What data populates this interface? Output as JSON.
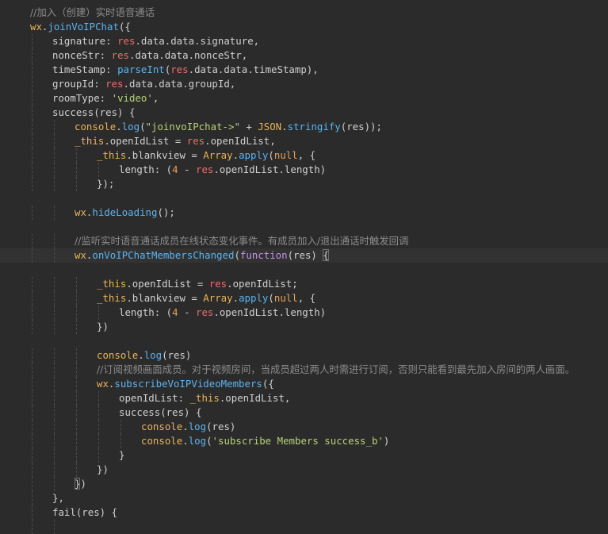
{
  "editor": {
    "current_line": 18,
    "matched_bracket": [
      18,
      33
    ],
    "lines": [
      {
        "indent": 1,
        "tokens": [
          {
            "t": "//加入（创建）实时语音通话",
            "c": "comment"
          }
        ]
      },
      {
        "indent": 1,
        "tokens": [
          {
            "t": "wx",
            "c": "wx"
          },
          {
            "t": ".",
            "c": "punct"
          },
          {
            "t": "joinVoIPChat",
            "c": "method"
          },
          {
            "t": "({",
            "c": "punct"
          }
        ]
      },
      {
        "indent": 2,
        "tokens": [
          {
            "t": "signature: ",
            "c": "ident"
          },
          {
            "t": "res",
            "c": "res"
          },
          {
            "t": ".data.data.signature,",
            "c": "ident"
          }
        ]
      },
      {
        "indent": 2,
        "tokens": [
          {
            "t": "nonceStr: ",
            "c": "ident"
          },
          {
            "t": "res",
            "c": "res"
          },
          {
            "t": ".data.data.nonceStr,",
            "c": "ident"
          }
        ]
      },
      {
        "indent": 2,
        "tokens": [
          {
            "t": "timeStamp: ",
            "c": "ident"
          },
          {
            "t": "parseInt",
            "c": "method"
          },
          {
            "t": "(",
            "c": "punct"
          },
          {
            "t": "res",
            "c": "res"
          },
          {
            "t": ".data.data.timeStamp),",
            "c": "ident"
          }
        ]
      },
      {
        "indent": 2,
        "tokens": [
          {
            "t": "groupId: ",
            "c": "ident"
          },
          {
            "t": "res",
            "c": "res"
          },
          {
            "t": ".data.data.groupId,",
            "c": "ident"
          }
        ]
      },
      {
        "indent": 2,
        "tokens": [
          {
            "t": "roomType: ",
            "c": "ident"
          },
          {
            "t": "'video'",
            "c": "string"
          },
          {
            "t": ",",
            "c": "punct"
          }
        ]
      },
      {
        "indent": 2,
        "tokens": [
          {
            "t": "success(res) {",
            "c": "ident"
          }
        ]
      },
      {
        "indent": 3,
        "tokens": [
          {
            "t": "console",
            "c": "builtin"
          },
          {
            "t": ".",
            "c": "punct"
          },
          {
            "t": "log",
            "c": "method"
          },
          {
            "t": "(",
            "c": "punct"
          },
          {
            "t": "\"joinvoIPchat->\"",
            "c": "string"
          },
          {
            "t": " + ",
            "c": "punct"
          },
          {
            "t": "JSON",
            "c": "builtin"
          },
          {
            "t": ".",
            "c": "punct"
          },
          {
            "t": "stringify",
            "c": "method"
          },
          {
            "t": "(res));",
            "c": "ident"
          }
        ]
      },
      {
        "indent": 3,
        "tokens": [
          {
            "t": "_this",
            "c": "this"
          },
          {
            "t": ".openIdList = ",
            "c": "ident"
          },
          {
            "t": "res",
            "c": "res"
          },
          {
            "t": ".openIdList,",
            "c": "ident"
          }
        ]
      },
      {
        "indent": 4,
        "tokens": [
          {
            "t": "_this",
            "c": "this"
          },
          {
            "t": ".blankview = ",
            "c": "ident"
          },
          {
            "t": "Array",
            "c": "builtin"
          },
          {
            "t": ".",
            "c": "punct"
          },
          {
            "t": "apply",
            "c": "method"
          },
          {
            "t": "(",
            "c": "punct"
          },
          {
            "t": "null",
            "c": "number"
          },
          {
            "t": ", {",
            "c": "punct"
          }
        ]
      },
      {
        "indent": 5,
        "tokens": [
          {
            "t": "length: (",
            "c": "ident"
          },
          {
            "t": "4",
            "c": "number"
          },
          {
            "t": " - ",
            "c": "punct"
          },
          {
            "t": "res",
            "c": "res"
          },
          {
            "t": ".openIdList.length)",
            "c": "ident"
          }
        ]
      },
      {
        "indent": 4,
        "tokens": [
          {
            "t": "});",
            "c": "punct"
          }
        ]
      },
      {
        "indent": 0,
        "tokens": []
      },
      {
        "indent": 3,
        "tokens": [
          {
            "t": "wx",
            "c": "wx"
          },
          {
            "t": ".",
            "c": "punct"
          },
          {
            "t": "hideLoading",
            "c": "method"
          },
          {
            "t": "();",
            "c": "punct"
          }
        ]
      },
      {
        "indent": 0,
        "tokens": []
      },
      {
        "indent": 3,
        "tokens": [
          {
            "t": "//监听实时语音通话成员在线状态变化事件。有成员加入/退出通话时触发回调",
            "c": "comment"
          }
        ]
      },
      {
        "indent": 3,
        "tokens": [
          {
            "t": "wx",
            "c": "wx"
          },
          {
            "t": ".",
            "c": "punct"
          },
          {
            "t": "onVoIPChatMembersChanged",
            "c": "method"
          },
          {
            "t": "(",
            "c": "punct"
          },
          {
            "t": "function",
            "c": "keyword"
          },
          {
            "t": "(res) ",
            "c": "ident"
          },
          {
            "t": "{",
            "c": "punct",
            "m": true
          }
        ]
      },
      {
        "indent": 0,
        "tokens": []
      },
      {
        "indent": 4,
        "tokens": [
          {
            "t": "_this",
            "c": "this"
          },
          {
            "t": ".openIdList = ",
            "c": "ident"
          },
          {
            "t": "res",
            "c": "res"
          },
          {
            "t": ".openIdList;",
            "c": "ident"
          }
        ]
      },
      {
        "indent": 4,
        "tokens": [
          {
            "t": "_this",
            "c": "this"
          },
          {
            "t": ".blankview = ",
            "c": "ident"
          },
          {
            "t": "Array",
            "c": "builtin"
          },
          {
            "t": ".",
            "c": "punct"
          },
          {
            "t": "apply",
            "c": "method"
          },
          {
            "t": "(",
            "c": "punct"
          },
          {
            "t": "null",
            "c": "number"
          },
          {
            "t": ", {",
            "c": "punct"
          }
        ]
      },
      {
        "indent": 5,
        "tokens": [
          {
            "t": "length: (",
            "c": "ident"
          },
          {
            "t": "4",
            "c": "number"
          },
          {
            "t": " - ",
            "c": "punct"
          },
          {
            "t": "res",
            "c": "res"
          },
          {
            "t": ".openIdList.length)",
            "c": "ident"
          }
        ]
      },
      {
        "indent": 4,
        "tokens": [
          {
            "t": "})",
            "c": "punct"
          }
        ]
      },
      {
        "indent": 0,
        "tokens": []
      },
      {
        "indent": 4,
        "tokens": [
          {
            "t": "console",
            "c": "builtin"
          },
          {
            "t": ".",
            "c": "punct"
          },
          {
            "t": "log",
            "c": "method"
          },
          {
            "t": "(res)",
            "c": "ident"
          }
        ]
      },
      {
        "indent": 4,
        "tokens": [
          {
            "t": "//订阅视频画面成员。对于视频房间，当成员超过两人时需进行订阅，否则只能看到最先加入房间的两人画面。",
            "c": "comment"
          }
        ]
      },
      {
        "indent": 4,
        "tokens": [
          {
            "t": "wx",
            "c": "wx"
          },
          {
            "t": ".",
            "c": "punct"
          },
          {
            "t": "subscribeVoIPVideoMembers",
            "c": "method"
          },
          {
            "t": "({",
            "c": "punct"
          }
        ]
      },
      {
        "indent": 5,
        "tokens": [
          {
            "t": "openIdList: ",
            "c": "ident"
          },
          {
            "t": "_this",
            "c": "this"
          },
          {
            "t": ".openIdList,",
            "c": "ident"
          }
        ]
      },
      {
        "indent": 5,
        "tokens": [
          {
            "t": "success(res) {",
            "c": "ident"
          }
        ]
      },
      {
        "indent": 6,
        "tokens": [
          {
            "t": "console",
            "c": "builtin"
          },
          {
            "t": ".",
            "c": "punct"
          },
          {
            "t": "log",
            "c": "method"
          },
          {
            "t": "(res)",
            "c": "ident"
          }
        ]
      },
      {
        "indent": 6,
        "tokens": [
          {
            "t": "console",
            "c": "builtin"
          },
          {
            "t": ".",
            "c": "punct"
          },
          {
            "t": "log",
            "c": "method"
          },
          {
            "t": "(",
            "c": "punct"
          },
          {
            "t": "'subscribe Members success_b'",
            "c": "string"
          },
          {
            "t": ")",
            "c": "punct"
          }
        ]
      },
      {
        "indent": 5,
        "tokens": [
          {
            "t": "}",
            "c": "punct"
          }
        ]
      },
      {
        "indent": 4,
        "tokens": [
          {
            "t": "})",
            "c": "punct"
          }
        ]
      },
      {
        "indent": 3,
        "tokens": [
          {
            "t": "}",
            "c": "punct",
            "m": true
          },
          {
            "t": ")",
            "c": "punct"
          }
        ]
      },
      {
        "indent": 2,
        "tokens": [
          {
            "t": "},",
            "c": "punct"
          }
        ]
      },
      {
        "indent": 2,
        "tokens": [
          {
            "t": "fail(res) {",
            "c": "ident"
          }
        ]
      },
      {
        "indent": 3,
        "tokens": []
      }
    ]
  }
}
